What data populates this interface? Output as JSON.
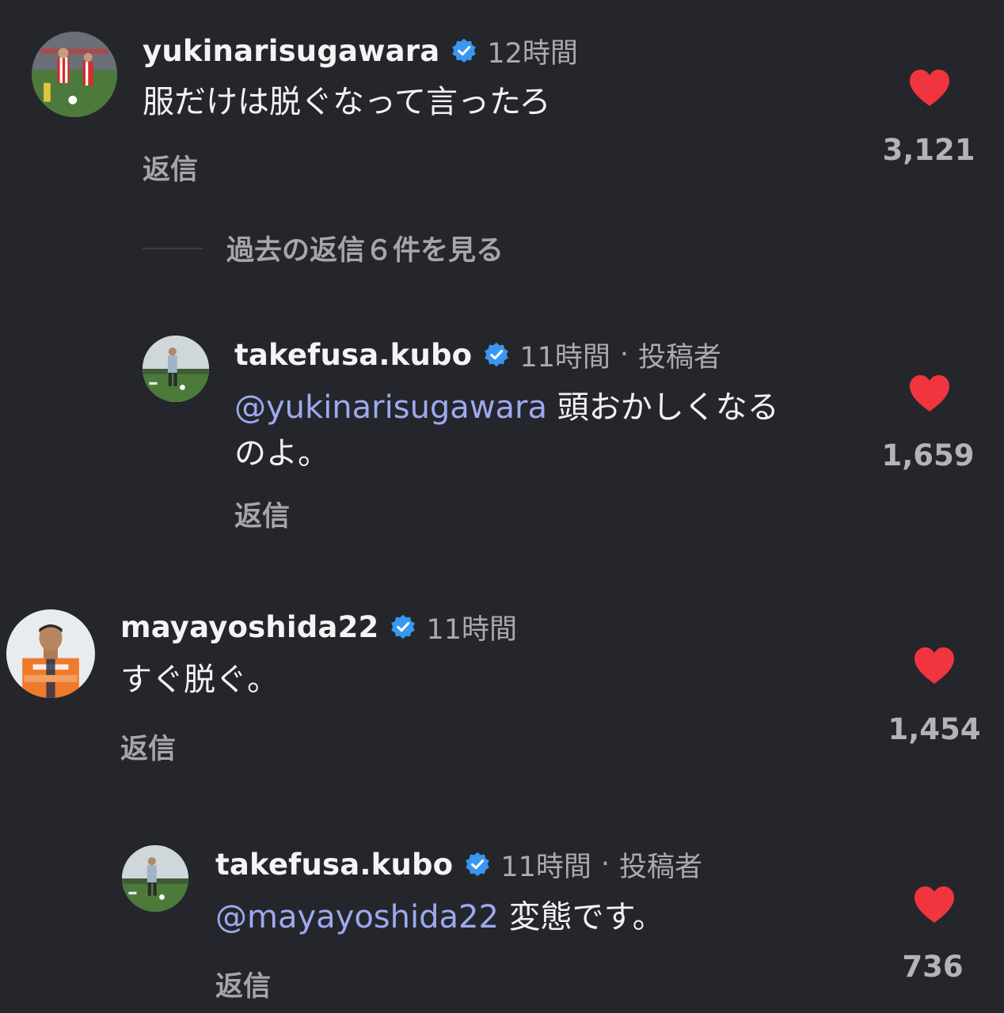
{
  "colors": {
    "background": "#25262b",
    "heart": "#f0353f",
    "verified": "#3897f0",
    "mention": "#9da9f0"
  },
  "comments": [
    {
      "username": "yukinarisugawara",
      "time": "12時間",
      "text": "服だけは脱ぐなって言ったろ",
      "reply_label": "返信",
      "likes": "3,121",
      "icons": [
        "verified-badge-icon",
        "heart-icon"
      ]
    },
    {
      "username": "takefusa.kubo",
      "time": "11時間",
      "author_tag": "投稿者",
      "separator": "·",
      "mention": "@yukinarisugawara",
      "text_line1": " 頭おかしくなる",
      "text_line2": "のよ。",
      "reply_label": "返信",
      "likes": "1,659"
    },
    {
      "username": "mayayoshida22",
      "time": "11時間",
      "text": "すぐ脱ぐ。",
      "reply_label": "返信",
      "likes": "1,454"
    },
    {
      "username": "takefusa.kubo",
      "time": "11時間",
      "author_tag": "投稿者",
      "separator": "·",
      "mention": "@mayayoshida22",
      "text": " 変態です。",
      "reply_label": "返信",
      "likes": "736"
    }
  ],
  "view_replies": {
    "label": "過去の返信６件を見る"
  }
}
